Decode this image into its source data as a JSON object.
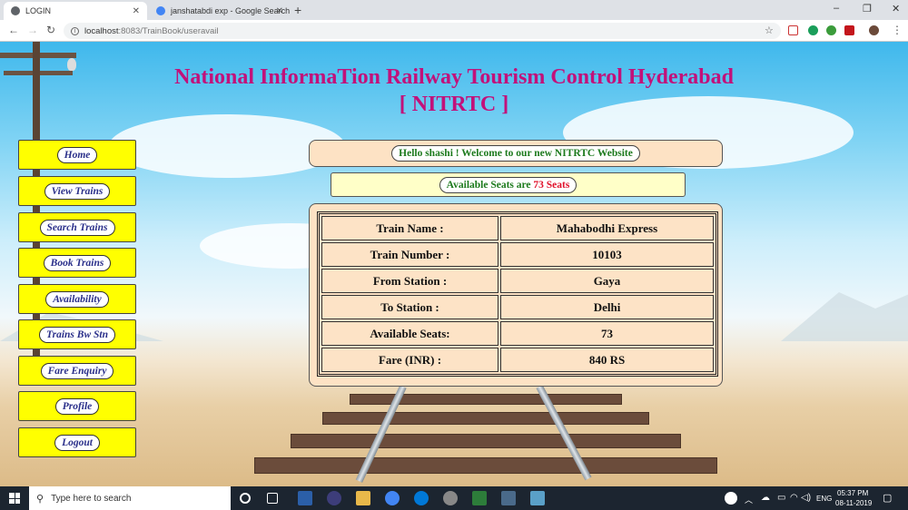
{
  "browser": {
    "tabs": [
      {
        "title": "LOGIN",
        "active": true
      },
      {
        "title": "janshatabdi exp - Google Search",
        "active": false
      }
    ],
    "url_host": "localhost",
    "url_rest": ":8083/TrainBook/useravail",
    "window_controls": {
      "minimize": "–",
      "maximize": "❐",
      "close": "✕"
    }
  },
  "site": {
    "title_line1": "National InformaTion Railway Tourism Control Hyderabad",
    "title_line2": "[ NITRTC ]",
    "title_color": "#c2117a"
  },
  "menu": [
    {
      "label": "Home"
    },
    {
      "label": "View Trains"
    },
    {
      "label": "Search Trains"
    },
    {
      "label": "Book Trains"
    },
    {
      "label": "Availability"
    },
    {
      "label": "Trains Bw Stn"
    },
    {
      "label": "Fare Enquiry"
    },
    {
      "label": "Profile"
    },
    {
      "label": "Logout"
    }
  ],
  "welcome": {
    "text": "Hello shashi ! Welcome to our new NITRTC Website"
  },
  "availability": {
    "prefix": "Available Seats are ",
    "seats_text": "73 Seats"
  },
  "train_info": [
    {
      "label": "Train Name :",
      "value": "Mahabodhi Express"
    },
    {
      "label": "Train Number :",
      "value": "10103"
    },
    {
      "label": "From Station :",
      "value": "Gaya"
    },
    {
      "label": "To Station :",
      "value": "Delhi"
    },
    {
      "label": "Available Seats:",
      "value": "73"
    },
    {
      "label": "Fare (INR) :",
      "value": "840 RS"
    }
  ],
  "taskbar": {
    "search_placeholder": "Type here to search",
    "language": "ENG",
    "time": "05:37 PM",
    "date": "08-11-2019"
  },
  "colors": {
    "menu_bg": "#ffff00",
    "card_bg": "#fde2c4",
    "welcome_text": "#1d7a1d",
    "seats_highlight": "#e0102a"
  }
}
